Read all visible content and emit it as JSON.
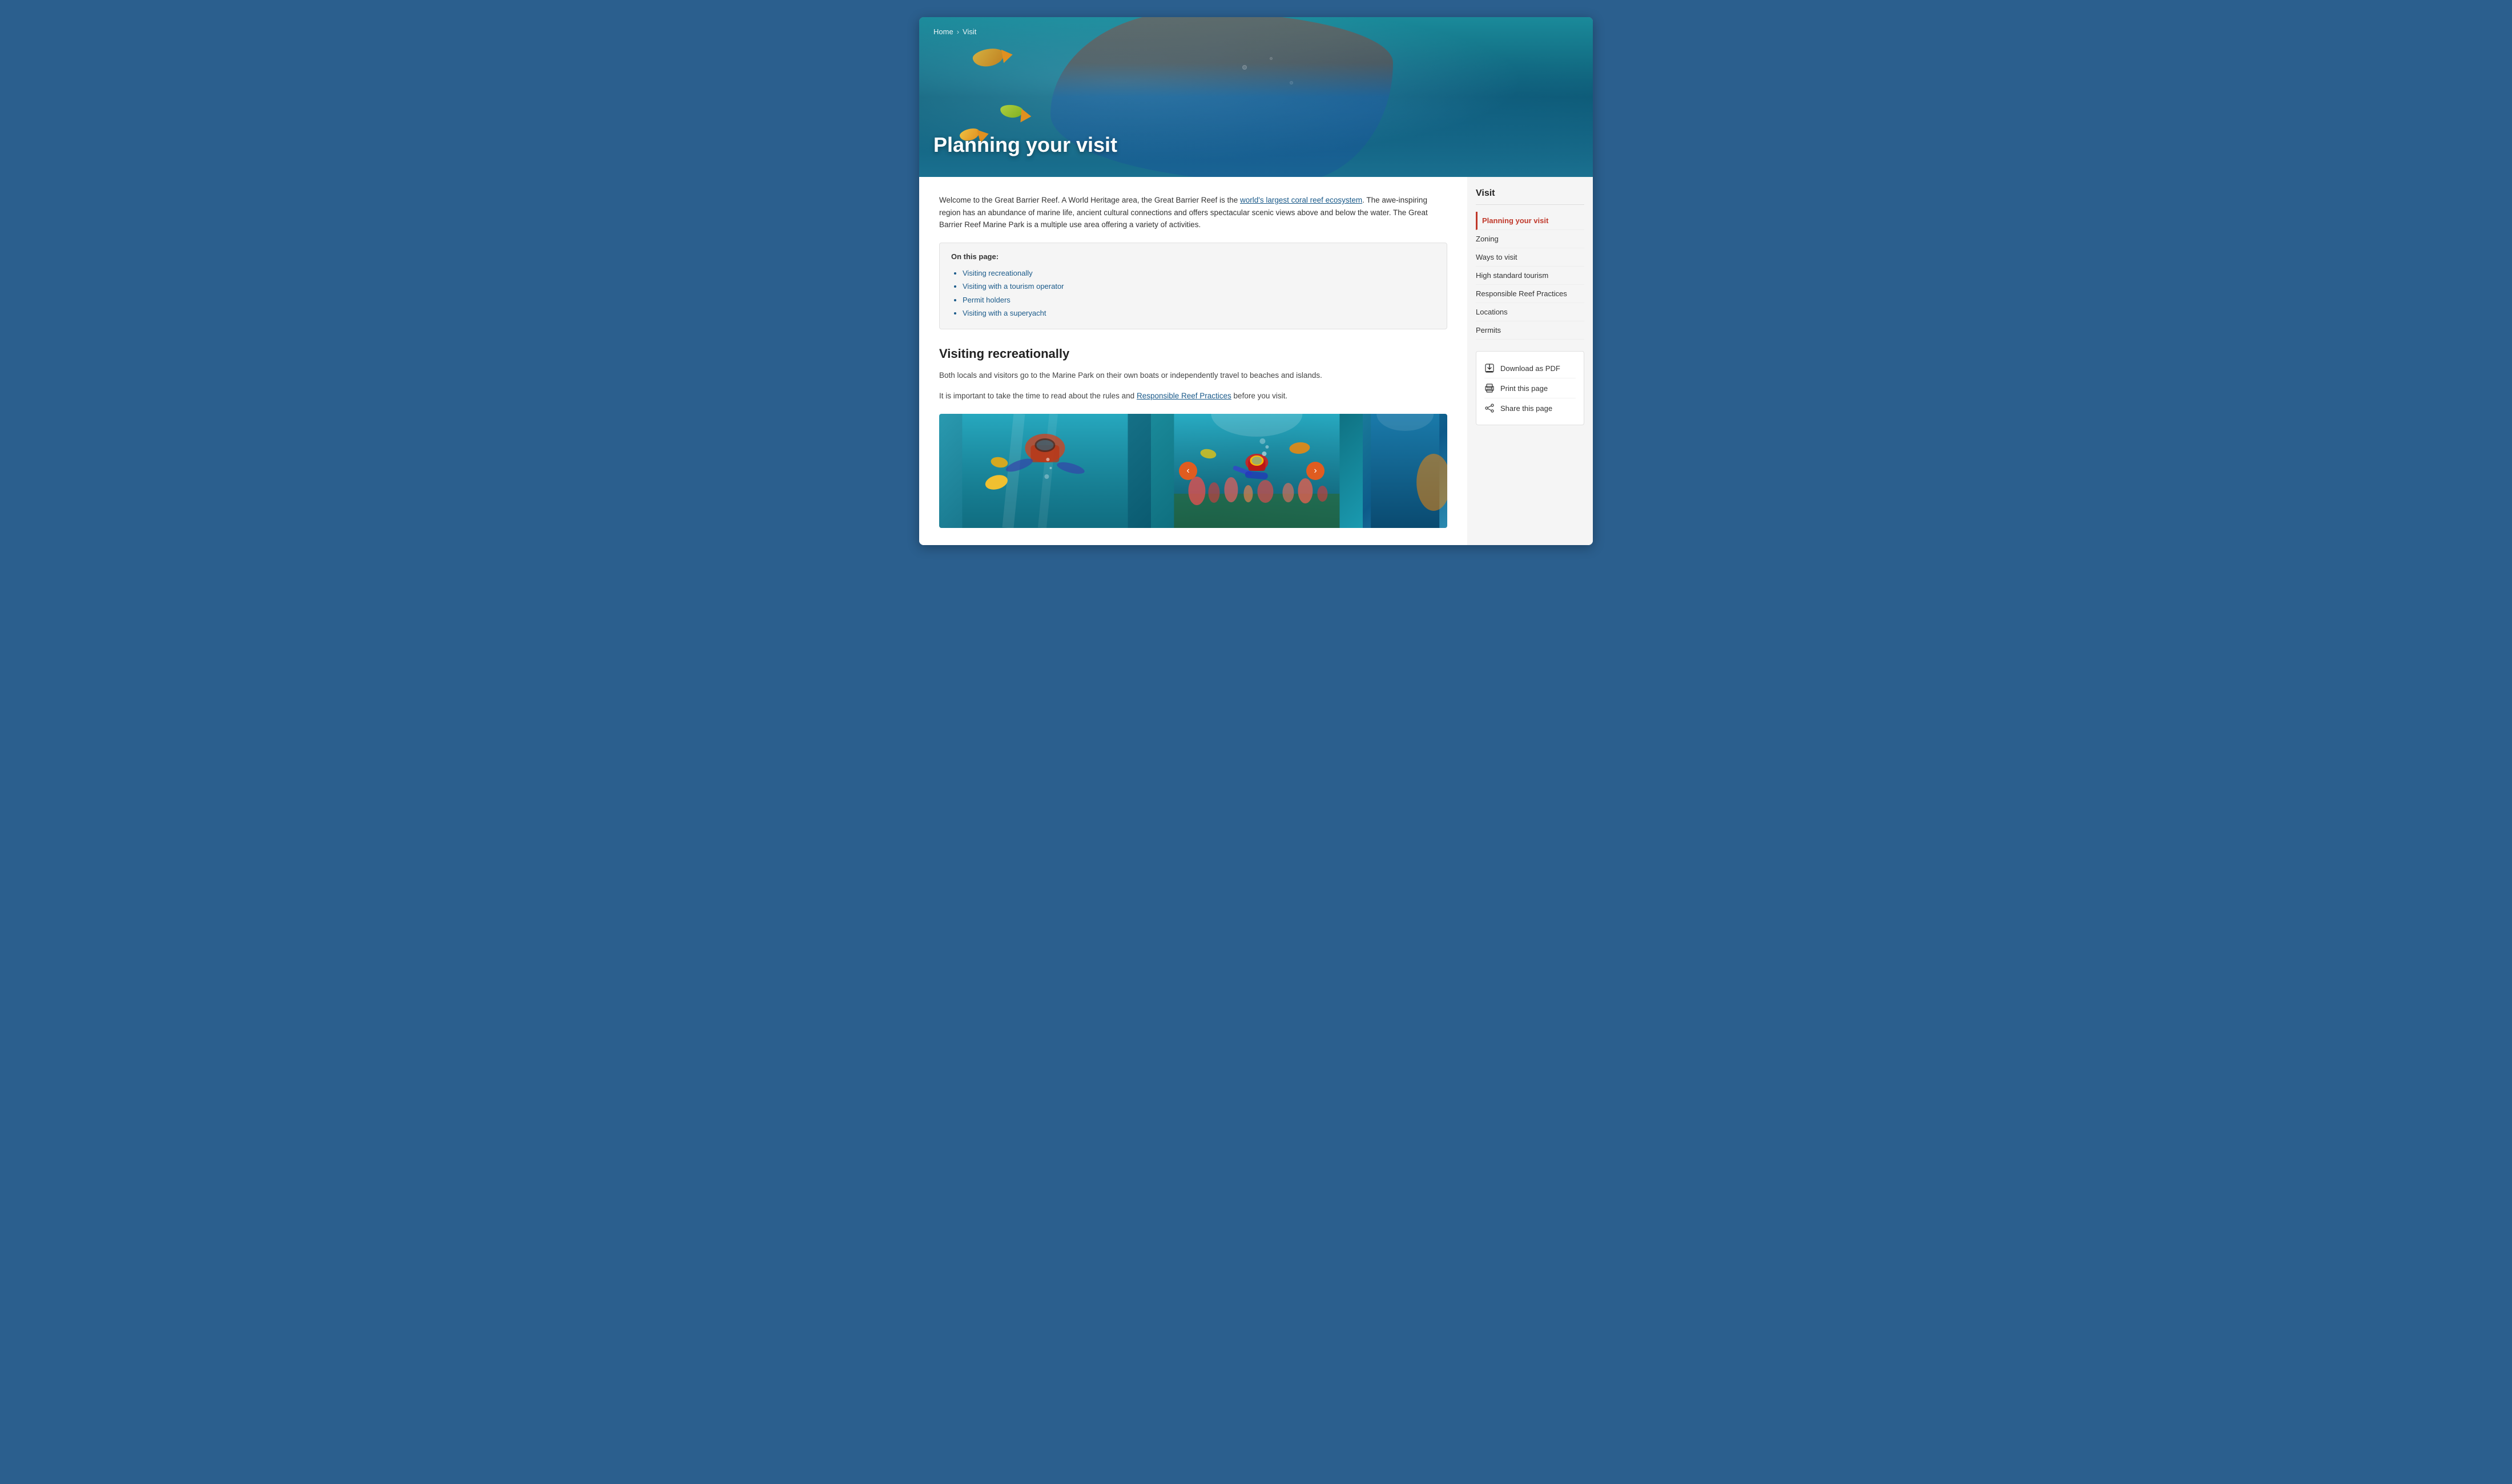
{
  "breadcrumb": {
    "home": "Home",
    "separator": "›",
    "current": "Visit"
  },
  "hero": {
    "title": "Planning your visit"
  },
  "sidebar": {
    "section_title": "Visit",
    "nav_items": [
      {
        "id": "planning-your-visit",
        "label": "Planning your visit",
        "active": true
      },
      {
        "id": "zoning",
        "label": "Zoning",
        "active": false
      },
      {
        "id": "ways-to-visit",
        "label": "Ways to visit",
        "active": false
      },
      {
        "id": "high-standard-tourism",
        "label": "High standard tourism",
        "active": false
      },
      {
        "id": "responsible-reef-practices",
        "label": "Responsible Reef Practices",
        "active": false
      },
      {
        "id": "locations",
        "label": "Locations",
        "active": false
      },
      {
        "id": "permits",
        "label": "Permits",
        "active": false
      }
    ],
    "actions": [
      {
        "id": "download-pdf",
        "label": "Download as PDF",
        "icon": "download-icon"
      },
      {
        "id": "print-page",
        "label": "Print this page",
        "icon": "print-icon"
      },
      {
        "id": "share-page",
        "label": "Share this page",
        "icon": "share-icon"
      }
    ]
  },
  "intro": {
    "text_1": "Welcome to the Great Barrier Reef. A World Heritage area, the Great Barrier Reef is the ",
    "link_text": "world's largest coral reef ecosystem",
    "text_2": ". The awe-inspiring region has an abundance of marine life, ancient cultural connections and offers spectacular scenic views above and below the water. The Great Barrier Reef Marine Park is a multiple use area offering a variety of activities."
  },
  "on_page": {
    "label": "On this page:",
    "items": [
      "Visiting recreationally",
      "Visiting with a tourism operator",
      "Permit holders",
      "Visiting with a superyacht"
    ]
  },
  "visiting_recreationally": {
    "heading": "Visiting recreationally",
    "text_1": "Both locals and visitors go to the Marine Park on their own boats or independently travel to beaches and islands.",
    "text_2": "It is important to take the time to read about the rules and ",
    "link_text": "Responsible Reef Practices",
    "text_3": " before you visit."
  }
}
